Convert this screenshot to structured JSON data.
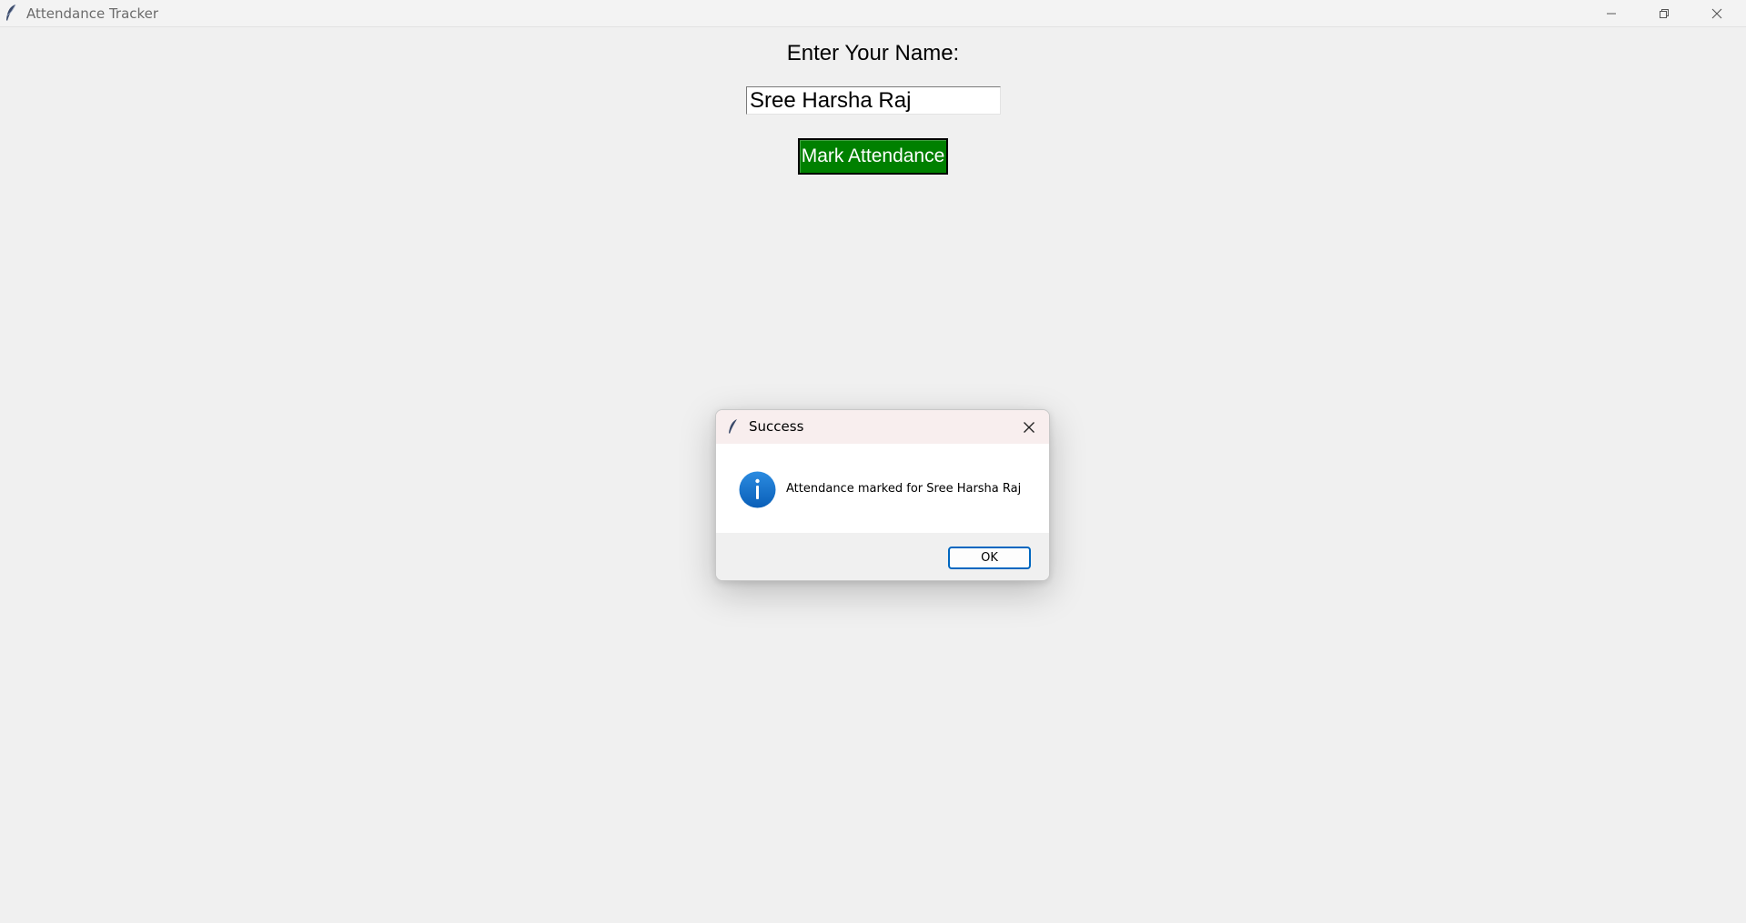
{
  "window": {
    "title": "Attendance Tracker",
    "icon": "feather-icon",
    "controls": [
      "minimize-icon",
      "restore-icon",
      "close-icon"
    ]
  },
  "form": {
    "label": "Enter Your Name:",
    "name_value": "Sree Harsha Raj",
    "button_label": "Mark Attendance",
    "button_color": "#008000"
  },
  "dialog": {
    "title": "Success",
    "icon": "info-icon",
    "message": "Attendance marked for Sree Harsha Raj",
    "ok_label": "OK",
    "accent_color": "#0067c0"
  }
}
